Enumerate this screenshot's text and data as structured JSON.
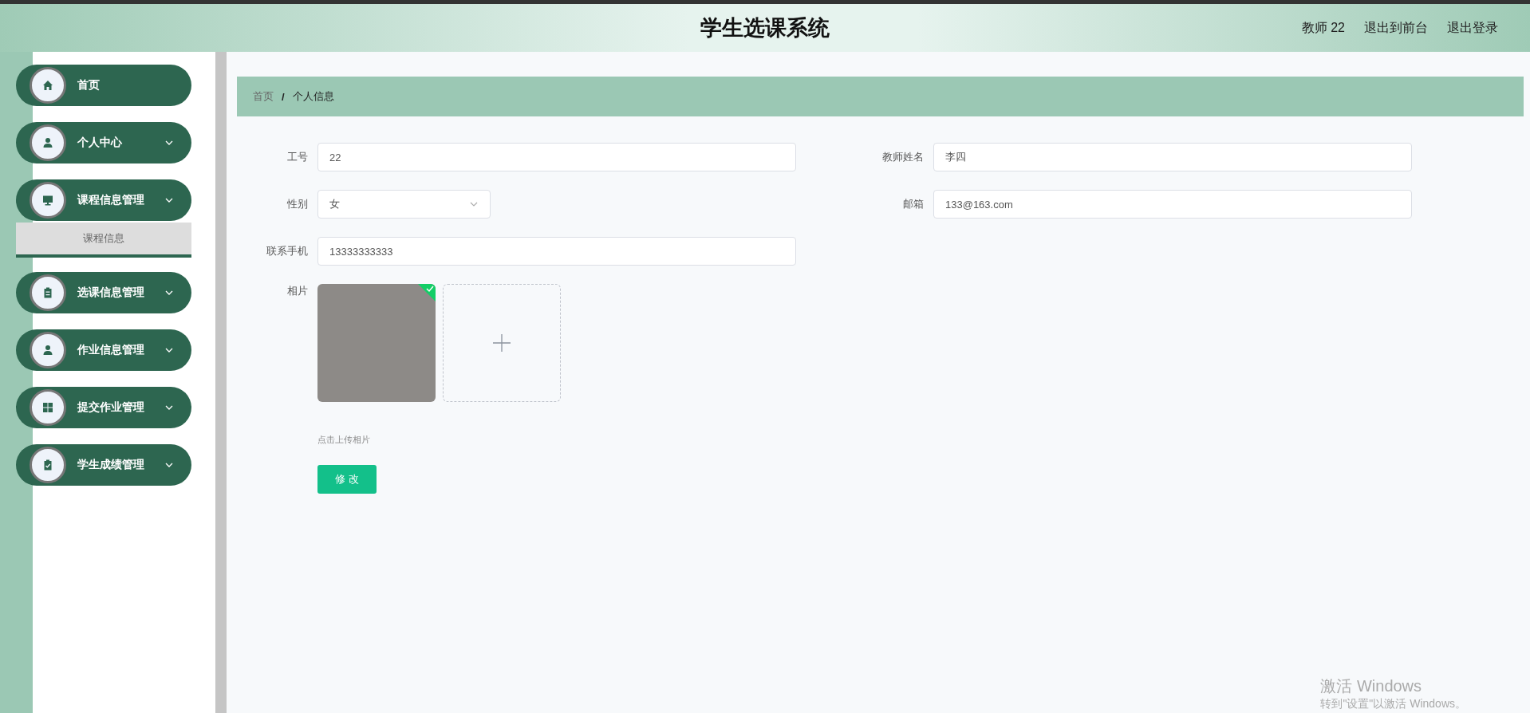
{
  "header": {
    "title": "学生选课系统",
    "user": "教师 22",
    "links": [
      "退出到前台",
      "退出登录"
    ]
  },
  "sidebar": {
    "items": [
      {
        "kind": "link",
        "label": "首页"
      },
      {
        "kind": "group",
        "label": "个人中心"
      },
      {
        "kind": "group",
        "label": "课程信息管理",
        "children": [
          {
            "label": "课程信息",
            "selected": true
          }
        ]
      },
      {
        "kind": "group",
        "label": "选课信息管理"
      },
      {
        "kind": "group",
        "label": "作业信息管理"
      },
      {
        "kind": "group",
        "label": "提交作业管理"
      },
      {
        "kind": "group",
        "label": "学生成绩管理"
      }
    ]
  },
  "breadcrumb": {
    "items": [
      "首页",
      "个人信息"
    ],
    "separator": "/"
  },
  "form": {
    "fields": [
      {
        "kind": "text",
        "label": "工号",
        "value": "22"
      },
      {
        "kind": "text",
        "label": "教师姓名",
        "value": "李四"
      },
      {
        "kind": "select",
        "label": "性别",
        "value": "女"
      },
      {
        "kind": "text",
        "label": "邮箱",
        "value": "133@163.com"
      },
      {
        "kind": "text",
        "label": "联系手机",
        "value": "13333333333"
      }
    ],
    "photo": {
      "label": "相片",
      "uploaded": true,
      "hint": "点击上传相片"
    },
    "submit": "修 改"
  },
  "os_notice": {
    "title": "激活 Windows",
    "text": "转到\"设置\"以激活 Windows。"
  }
}
